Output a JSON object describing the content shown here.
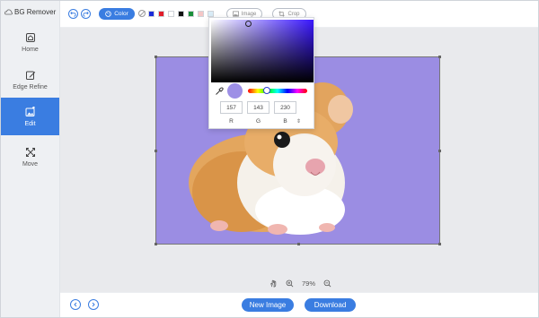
{
  "app": {
    "title": "BG Remover"
  },
  "sidebar": {
    "items": [
      {
        "label": "Home",
        "icon": "home-icon",
        "active": false
      },
      {
        "label": "Edge Refine",
        "icon": "edit-pen-icon",
        "active": false
      },
      {
        "label": "Edit",
        "icon": "image-edit-icon",
        "active": true
      },
      {
        "label": "Move",
        "icon": "move-arrows-icon",
        "active": false
      }
    ]
  },
  "toolbar": {
    "color_label": "Color",
    "image_label": "Image",
    "crop_label": "Crop",
    "swatches": [
      "#1a2bd8",
      "#e11d2a",
      "#ffffff",
      "#111111",
      "#1b8f3a",
      "#f4c6c6",
      "#d9ecf7"
    ]
  },
  "canvas": {
    "background_color": "#9b8de3"
  },
  "color_picker": {
    "r": "157",
    "g": "143",
    "b": "230",
    "r_label": "R",
    "g_label": "G",
    "b_label": "B",
    "mode_toggle": "⇕"
  },
  "zoom": {
    "level": "79%"
  },
  "bottom": {
    "new_image_label": "New Image",
    "download_label": "Download"
  },
  "colors": {
    "accent": "#3a7de1"
  }
}
